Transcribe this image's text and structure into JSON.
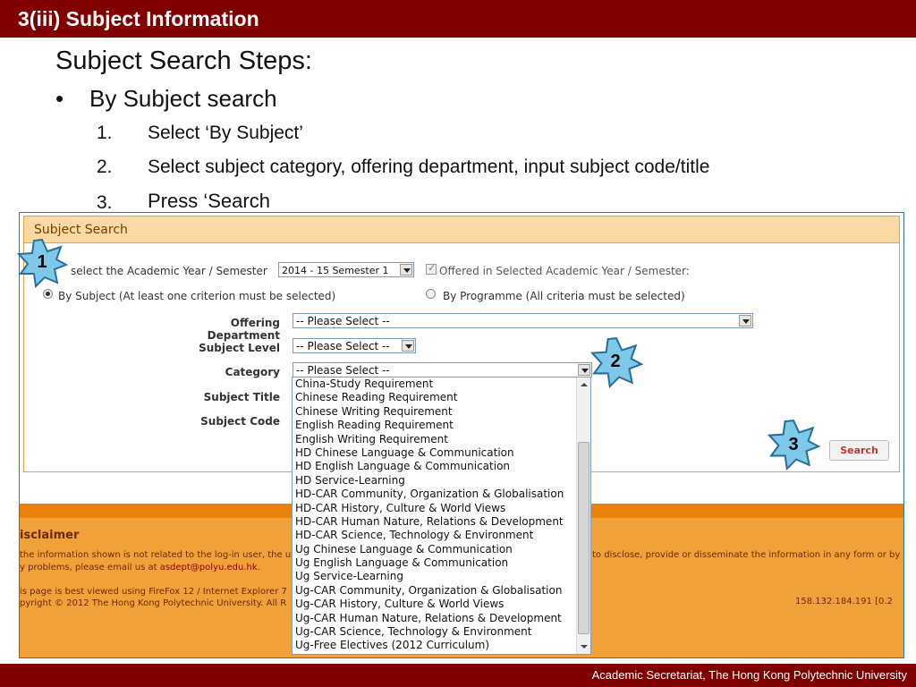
{
  "slide": {
    "title": "3(iii) Subject Information",
    "heading": "Subject Search Steps:",
    "bullet": "By Subject search",
    "steps": [
      {
        "num": "1.",
        "text": "Select ‘By Subject’"
      },
      {
        "num": "2.",
        "text": "Select subject category, offering department, input subject code/title"
      },
      {
        "num": "3.",
        "text": "Press ‘Search"
      }
    ],
    "footer": "Academic Secretariat, The Hong Kong Polytechnic University"
  },
  "panel": {
    "title": "Subject Search",
    "academic_year_label": "select the Academic Year / Semester",
    "academic_year_value": "2014 - 15  Semester 1",
    "offered_label": "Offered in Selected Academic Year / Semester:",
    "by_subject_label": "By Subject (At least one criterion must be selected)",
    "by_programme_label": "By Programme (All criteria must be selected)",
    "fields": {
      "offering_department": {
        "label": "Offering Department",
        "value": "-- Please Select --"
      },
      "subject_level": {
        "label": "Subject Level",
        "value": "-- Please Select --"
      },
      "category": {
        "label": "Category",
        "value": "-- Please Select --"
      },
      "subject_title": {
        "label": "Subject Title"
      },
      "subject_code": {
        "label": "Subject Code"
      }
    },
    "search_label": "Search"
  },
  "category_options": [
    "China-Study Requirement",
    "Chinese Reading Requirement",
    "Chinese Writing Requirement",
    "English Reading Requirement",
    "English Writing Requirement",
    "HD Chinese Language & Communication",
    "HD English Language & Communication",
    "HD Service-Learning",
    "HD-CAR Community, Organization & Globalisation",
    "HD-CAR History, Culture & World Views",
    "HD-CAR Human Nature, Relations & Development",
    "HD-CAR Science, Technology & Environment",
    "Ug Chinese Language & Communication",
    "Ug English Language & Communication",
    "Ug Service-Learning",
    "Ug-CAR Community, Organization & Globalisation",
    "Ug-CAR History, Culture & World Views",
    "Ug-CAR Human Nature, Relations & Development",
    "Ug-CAR Science, Technology & Environment",
    "Ug-Free Electives (2012 Curriculum)"
  ],
  "disclaimer": {
    "title": "isclaimer",
    "line1": "the information shown is not related to the log-in user, the us",
    "line1_right": "to disclose, provide or disseminate the information in any form or by a",
    "line2_prefix": "y problems, please email us at ",
    "line2_email": "asdept@polyu.edu.hk",
    "line2_suffix": ".",
    "line3": "is page is best viewed using FireFox 12 / Internet Explorer 7",
    "line4": "pyright © 2012 The Hong Kong Polytechnic University. All R",
    "ip": "158.132.184.191 [0.2"
  },
  "callouts": [
    "1",
    "2",
    "3"
  ],
  "colors": {
    "title_bar": "#800000",
    "panel_header": "#fbd9a5",
    "orange_band": "#e8820c",
    "disclaimer_bg": "#f0a13a",
    "callout_star": "#7ec8ea"
  }
}
